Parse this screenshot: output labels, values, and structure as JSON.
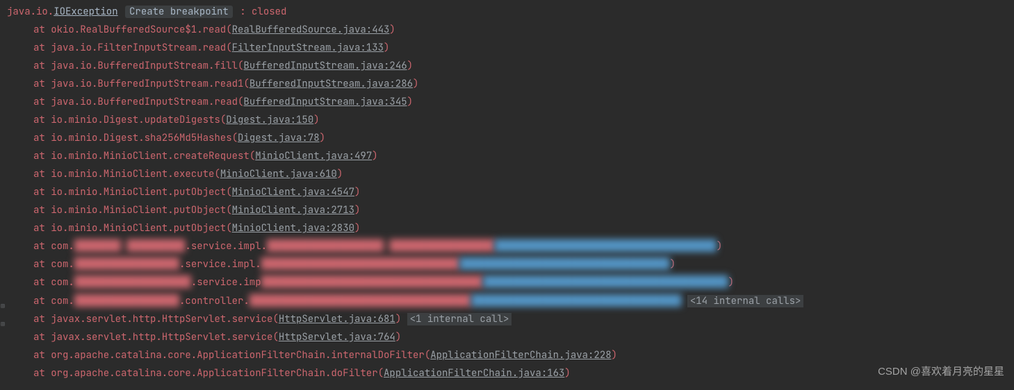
{
  "exception": {
    "package": "java.io.",
    "class": "IOException",
    "create_breakpoint": "Create breakpoint",
    "sep": " : ",
    "message": "closed"
  },
  "frames": [
    {
      "call": "okio.RealBufferedSource$1.read",
      "src": "RealBufferedSource.java:443"
    },
    {
      "call": "java.io.FilterInputStream.read",
      "src": "FilterInputStream.java:133"
    },
    {
      "call": "java.io.BufferedInputStream.fill",
      "src": "BufferedInputStream.java:246"
    },
    {
      "call": "java.io.BufferedInputStream.read1",
      "src": "BufferedInputStream.java:286"
    },
    {
      "call": "java.io.BufferedInputStream.read",
      "src": "BufferedInputStream.java:345"
    },
    {
      "call": "io.minio.Digest.updateDigests",
      "src": "Digest.java:150"
    },
    {
      "call": "io.minio.Digest.sha256Md5Hashes",
      "src": "Digest.java:78"
    },
    {
      "call": "io.minio.MinioClient.createRequest",
      "src": "MinioClient.java:497"
    },
    {
      "call": "io.minio.MinioClient.execute",
      "src": "MinioClient.java:610"
    },
    {
      "call": "io.minio.MinioClient.putObject",
      "src": "MinioClient.java:4547"
    },
    {
      "call": "io.minio.MinioClient.putObject",
      "src": "MinioClient.java:2713"
    },
    {
      "call": "io.minio.MinioClient.putObject",
      "src": "MinioClient.java:2830"
    }
  ],
  "obfuscated": [
    {
      "prefix": "com.",
      "red": "████████ ██████████",
      "mid": ".service.impl.",
      "red2": "████████████████████ ██████████████████",
      "blue": "██████████████████████████████████████",
      "paren": ")"
    },
    {
      "prefix": "com.",
      "red": "██████████████████",
      "mid": ".service.impl.",
      "red2": "██████████████████████████████████",
      "blue": "████████████████████████████████████",
      "paren": ")"
    },
    {
      "prefix": "com.",
      "red": "████████████████████",
      "mid": ".service.imp",
      "red2": "██████████████████████████████████████",
      "blue": "██████████████████████████████████████████",
      "paren": ")"
    },
    {
      "prefix": "com.",
      "red": "██████████████████",
      "mid": ".controller.",
      "red2": "██████████████████████████████████████",
      "blue": "████████████████████████████████████",
      "paren": "",
      "internal": "<14 internal calls>"
    }
  ],
  "frames2": [
    {
      "call": "javax.servlet.http.HttpServlet.service",
      "src": "HttpServlet.java:681",
      "internal": "<1 internal call>"
    },
    {
      "call": "javax.servlet.http.HttpServlet.service",
      "src": "HttpServlet.java:764"
    },
    {
      "call": "org.apache.catalina.core.ApplicationFilterChain.internalDoFilter",
      "src": "ApplicationFilterChain.java:228"
    },
    {
      "call": "org.apache.catalina.core.ApplicationFilterChain.doFilter",
      "src": "ApplicationFilterChain.java:163"
    }
  ],
  "at_label": "at ",
  "watermark": "CSDN @喜欢着月亮的星星",
  "gutter": {
    "expand": "⊞"
  }
}
